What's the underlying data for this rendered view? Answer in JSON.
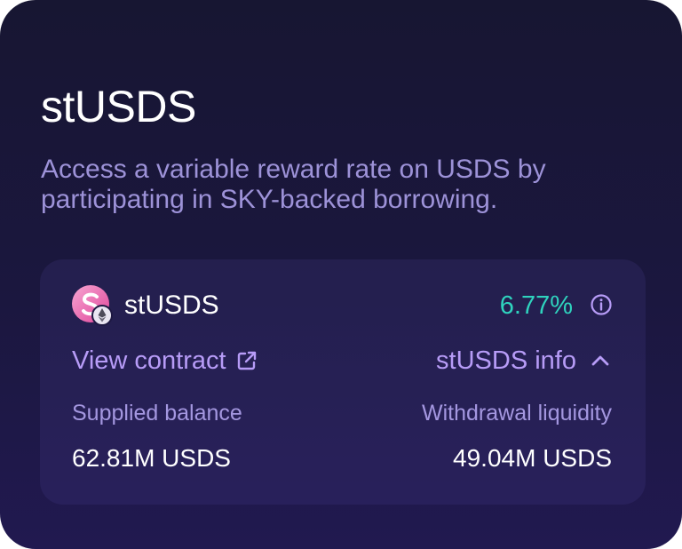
{
  "card": {
    "title": "stUSDS",
    "description": "Access a variable reward rate on USDS by participating in SKY-backed borrowing."
  },
  "token": {
    "name": "stUSDS",
    "logo_icon": "stusds-logo-with-ethereum-badge",
    "rate": "6.77%",
    "rate_color": "#2fd3be"
  },
  "links": {
    "view_contract": "View contract",
    "info_toggle": "stUSDS info",
    "link_color": "#b79cf7"
  },
  "stats": {
    "supplied_label": "Supplied balance",
    "supplied_value": "62.81M USDS",
    "liquidity_label": "Withdrawal liquidity",
    "liquidity_value": "49.04M USDS"
  }
}
